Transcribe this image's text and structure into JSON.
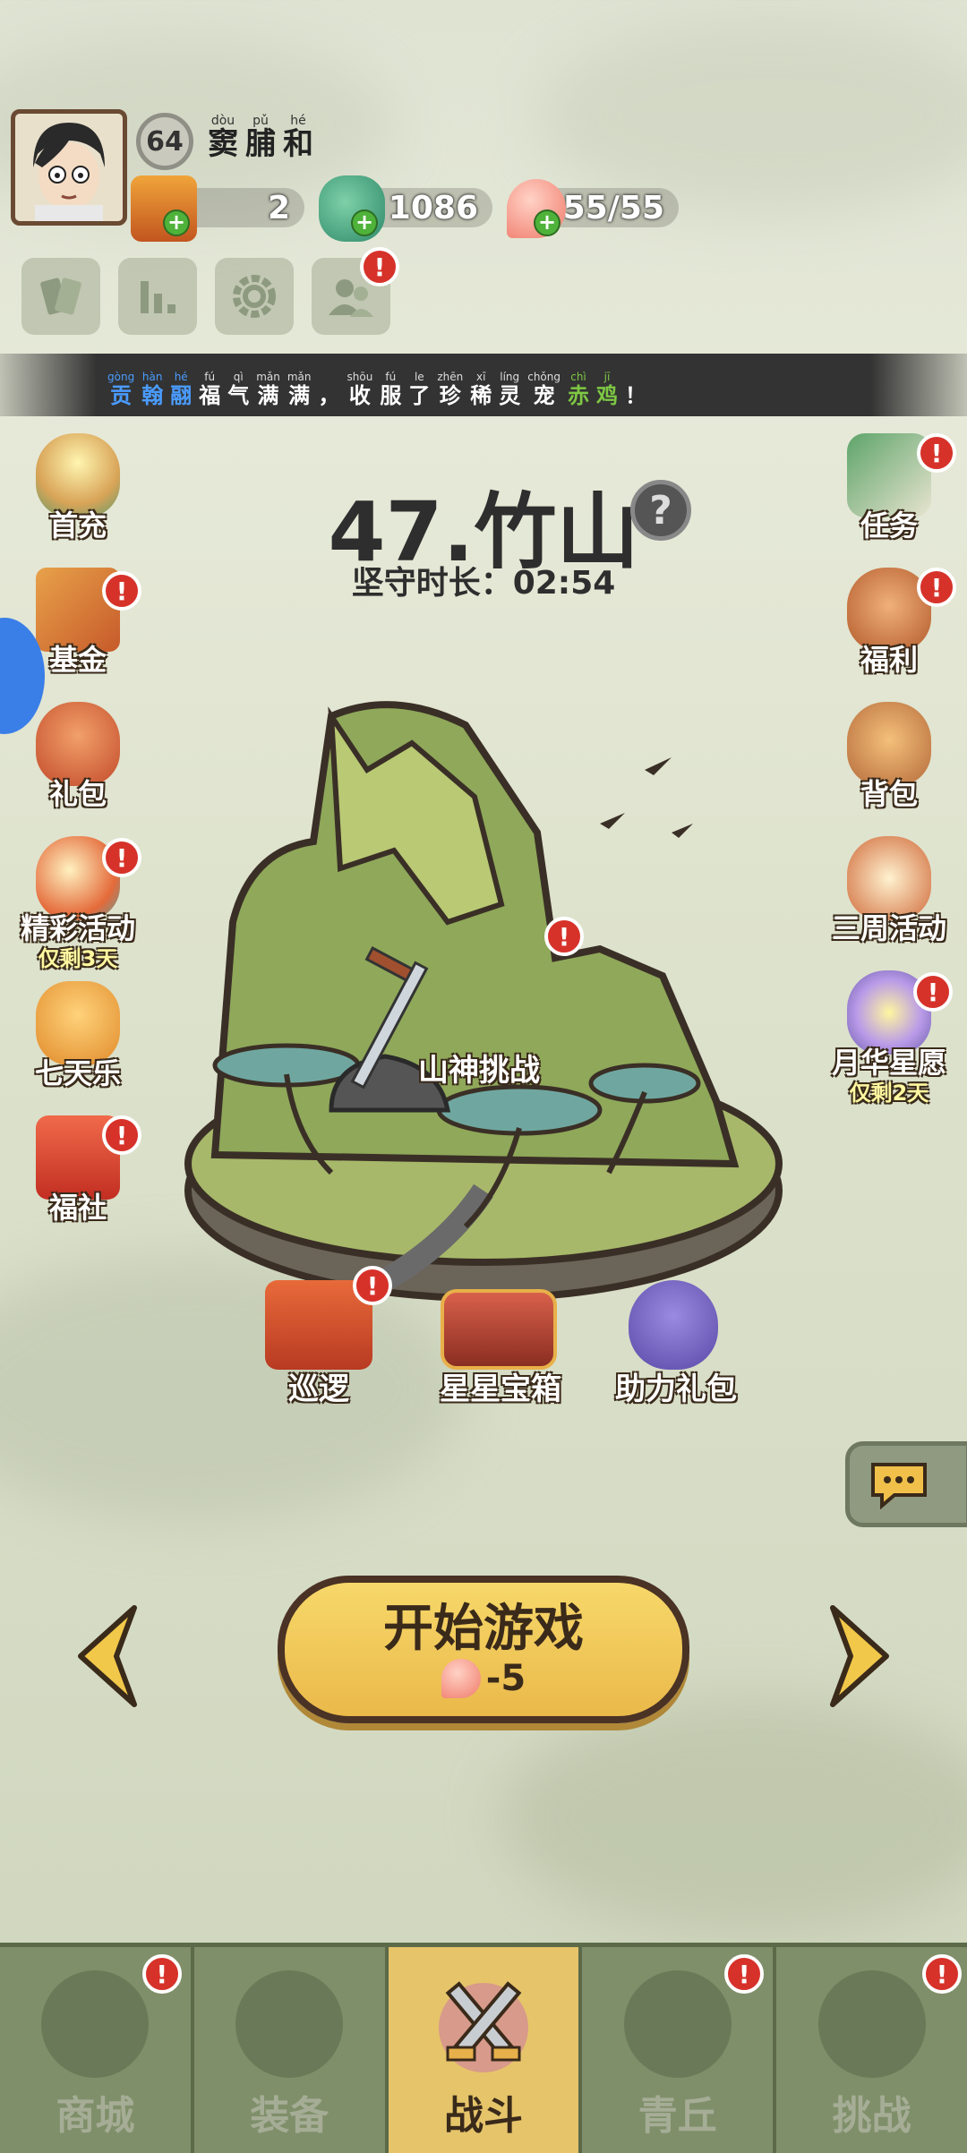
{
  "player": {
    "level": "64",
    "name": [
      {
        "py": "dòu",
        "hz": "窦"
      },
      {
        "py": "pǔ",
        "hz": "脯"
      },
      {
        "py": "hé",
        "hz": "和"
      }
    ]
  },
  "resources": {
    "tickets": "2",
    "jade": "1086",
    "stamina": "55/55"
  },
  "banner": [
    {
      "py": "gòng",
      "hz": "贡",
      "c": "blue"
    },
    {
      "py": "hàn",
      "hz": "翰",
      "c": "blue"
    },
    {
      "py": "hé",
      "hz": "翮",
      "c": "blue"
    },
    {
      "py": "fú",
      "hz": "福",
      "c": ""
    },
    {
      "py": "qì",
      "hz": "气",
      "c": ""
    },
    {
      "py": "mǎn",
      "hz": "满",
      "c": ""
    },
    {
      "py": "mǎn",
      "hz": "满",
      "c": ""
    },
    {
      "py": "",
      "hz": "，",
      "c": ""
    },
    {
      "py": "shōu",
      "hz": "收",
      "c": ""
    },
    {
      "py": "fú",
      "hz": "服",
      "c": ""
    },
    {
      "py": "le",
      "hz": "了",
      "c": ""
    },
    {
      "py": "zhēn",
      "hz": "珍",
      "c": ""
    },
    {
      "py": "xī",
      "hz": "稀",
      "c": ""
    },
    {
      "py": "líng",
      "hz": "灵",
      "c": ""
    },
    {
      "py": "chǒng",
      "hz": "宠",
      "c": ""
    },
    {
      "py": "chì",
      "hz": "赤",
      "c": "green"
    },
    {
      "py": "jī",
      "hz": "鸡",
      "c": "green"
    },
    {
      "py": "",
      "hz": "！",
      "c": ""
    }
  ],
  "stage": {
    "title": "47.竹山",
    "timer": "坚守时长：02:54"
  },
  "left_icons": {
    "first_charge": "首充",
    "fund": "基金",
    "gift": "礼包",
    "event": "精彩活动",
    "event_sub": "仅剩3天",
    "seven_days": "七天乐",
    "welfare_club": "福社"
  },
  "right_icons": {
    "tasks": "任务",
    "benefits": "福利",
    "bag": "背包",
    "anniversary": "三周活动",
    "wish": "月华星愿",
    "wish_sub": "仅剩2天"
  },
  "scene": {
    "boss": "山神挑战",
    "patrol": "巡逻",
    "star_chest": "星星宝箱",
    "assist_gift": "助力礼包"
  },
  "start": {
    "label": "开始游戏",
    "cost": "-5"
  },
  "nav": {
    "shop": "商城",
    "equipment": "装备",
    "battle": "战斗",
    "qingqiu": "青丘",
    "challenge": "挑战"
  },
  "badge_mark": "!"
}
